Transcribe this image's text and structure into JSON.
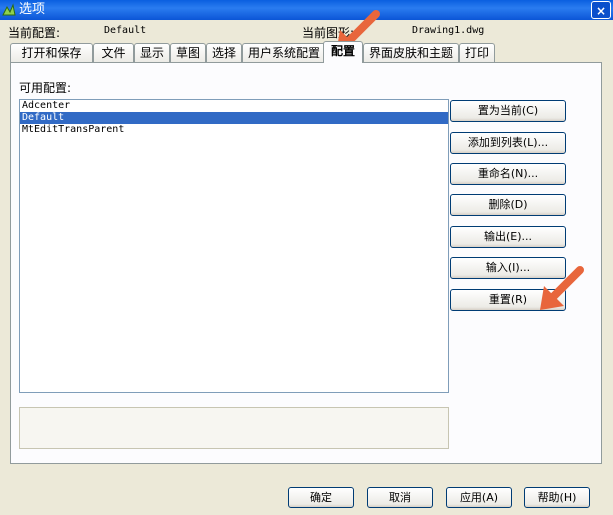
{
  "window": {
    "title": "选项",
    "close_glyph": "×"
  },
  "info": {
    "current_profile_label": "当前配置:",
    "current_profile_value": "Default",
    "current_drawing_label": "当前图形:",
    "current_drawing_value": "Drawing1.dwg"
  },
  "tabs": [
    {
      "label": "打开和保存"
    },
    {
      "label": "文件"
    },
    {
      "label": "显示"
    },
    {
      "label": "草图"
    },
    {
      "label": "选择"
    },
    {
      "label": "用户系统配置"
    },
    {
      "label": "配置"
    },
    {
      "label": "界面皮肤和主题"
    },
    {
      "label": "打印"
    }
  ],
  "active_tab": "配置",
  "profiles": {
    "label": "可用配置:",
    "items": [
      "Adcenter",
      "Default",
      "MtEditTransParent"
    ],
    "selected": "Default"
  },
  "side_buttons": {
    "set_current": "置为当前(C)",
    "add_to_list": "添加到列表(L)...",
    "rename": "重命名(N)...",
    "delete": "删除(D)",
    "export": "输出(E)...",
    "import": "输入(I)...",
    "reset": "重置(R)"
  },
  "bottom_buttons": {
    "ok": "确定",
    "cancel": "取消",
    "apply": "应用(A)",
    "help": "帮助(H)"
  },
  "colors": {
    "titlebar": "#0a5fe0",
    "selection": "#316ac5",
    "annotation_arrow": "#e8663c"
  }
}
